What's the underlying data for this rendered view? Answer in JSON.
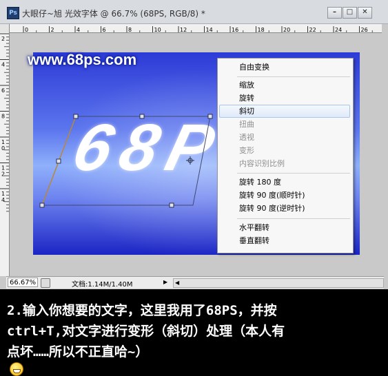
{
  "window": {
    "app_icon": "Ps",
    "title": "大眼仔~旭 光效字体 @ 66.7% (68PS, RGB/8) *",
    "buttons": [
      "minimize-icon",
      "restore-icon",
      "close-icon"
    ]
  },
  "rulers": {
    "horizontal_ticks": [
      "0",
      "2",
      "4",
      "6",
      "8",
      "10",
      "12",
      "14",
      "16",
      "18",
      "20",
      "22",
      "24",
      "26"
    ],
    "vertical_ticks": [
      "2",
      "4",
      "6",
      "8",
      "1 0",
      "1 2",
      "1 4"
    ]
  },
  "canvas": {
    "watermark": "www.68ps.com",
    "big_text": "68P"
  },
  "context_menu": {
    "items": [
      {
        "label": "自由变换",
        "enabled": true
      },
      {
        "label": "缩放",
        "enabled": true
      },
      {
        "label": "旋转",
        "enabled": true
      },
      {
        "label": "斜切",
        "enabled": true,
        "highlighted": true
      },
      {
        "label": "扭曲",
        "enabled": false
      },
      {
        "label": "透视",
        "enabled": false
      },
      {
        "label": "变形",
        "enabled": false
      },
      {
        "label": "内容识别比例",
        "enabled": false
      },
      {
        "label": "旋转 180 度",
        "enabled": true
      },
      {
        "label": "旋转 90 度(顺时针)",
        "enabled": true
      },
      {
        "label": "旋转 90 度(逆时针)",
        "enabled": true
      },
      {
        "label": "水平翻转",
        "enabled": true
      },
      {
        "label": "垂直翻转",
        "enabled": true
      }
    ]
  },
  "statusbar": {
    "zoom": "66.67%",
    "doc_info": "文档:1.14M/1.40M"
  },
  "caption": {
    "line1": "2.输入你想要的文字，这里我用了68PS，并按",
    "line2": "ctrl+T,对文字进行变形（斜切）处理（本人有",
    "line3": "点坏……所以不正直哈~）",
    "emoji": "grinning-face-icon"
  },
  "colors": {
    "canvas_dark": "#1b24c4",
    "canvas_light": "#8fb0fb",
    "menu_highlight": "#dfeaf9"
  }
}
